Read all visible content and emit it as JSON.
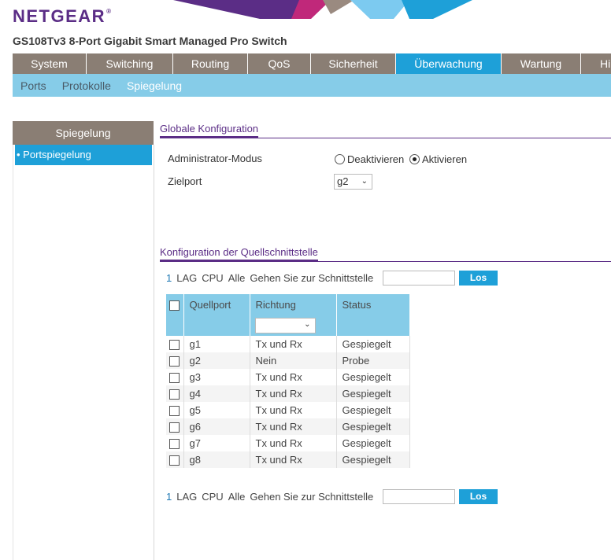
{
  "header": {
    "logo": "NETGEAR",
    "product_title": "GS108Tv3 8-Port Gigabit Smart Managed Pro Switch"
  },
  "main_nav": [
    {
      "label": "System"
    },
    {
      "label": "Switching"
    },
    {
      "label": "Routing"
    },
    {
      "label": "QoS"
    },
    {
      "label": "Sicherheit"
    },
    {
      "label": "Überwachung",
      "active": true
    },
    {
      "label": "Wartung"
    },
    {
      "label": "Hi"
    }
  ],
  "sub_nav": [
    "Ports",
    "Protokolle",
    "Spiegelung"
  ],
  "sidebar": {
    "title": "Spiegelung",
    "items": [
      "• Portspiegelung"
    ]
  },
  "global_config": {
    "title": "Globale Konfiguration",
    "admin_mode_label": "Administrator-Modus",
    "option_off": "Deaktivieren",
    "option_on": "Aktivieren",
    "selected": "Aktivieren",
    "dest_port_label": "Zielport",
    "dest_port_value": "g2"
  },
  "source_config": {
    "title": "Konfiguration der Quellschnittstelle",
    "filter": {
      "links": [
        "1",
        "LAG",
        "CPU",
        "Alle"
      ],
      "goto_label": "Gehen Sie zur Schnittstelle",
      "button": "Los"
    },
    "columns": [
      "Quellport",
      "Richtung",
      "Status"
    ],
    "rows": [
      {
        "port": "g1",
        "direction": "Tx und Rx",
        "status": "Gespiegelt"
      },
      {
        "port": "g2",
        "direction": "Nein",
        "status": "Probe"
      },
      {
        "port": "g3",
        "direction": "Tx und Rx",
        "status": "Gespiegelt"
      },
      {
        "port": "g4",
        "direction": "Tx und Rx",
        "status": "Gespiegelt"
      },
      {
        "port": "g5",
        "direction": "Tx und Rx",
        "status": "Gespiegelt"
      },
      {
        "port": "g6",
        "direction": "Tx und Rx",
        "status": "Gespiegelt"
      },
      {
        "port": "g7",
        "direction": "Tx und Rx",
        "status": "Gespiegelt"
      },
      {
        "port": "g8",
        "direction": "Tx und Rx",
        "status": "Gespiegelt"
      }
    ]
  },
  "colors": {
    "brand_purple": "#5b2d86",
    "nav_gray": "#8a7e74",
    "accent_blue": "#1ea0d8",
    "light_blue": "#86cce8"
  }
}
